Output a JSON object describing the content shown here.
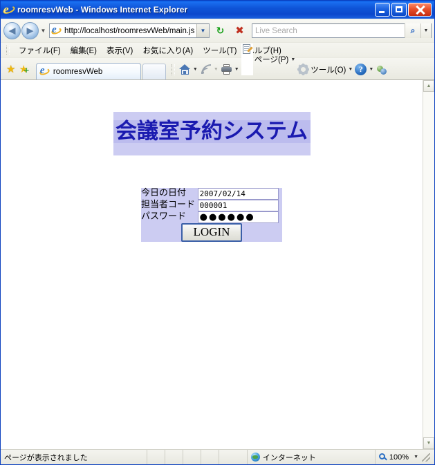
{
  "window": {
    "title": "roomresvWeb - Windows Internet Explorer",
    "minimize_label": "Minimize",
    "maximize_label": "Maximize",
    "close_label": "Close"
  },
  "navigation": {
    "back_glyph": "◀",
    "forward_glyph": "▶",
    "recent_caret": "▼",
    "url": "http://localhost/roomresvWeb/main.js",
    "url_dropdown_caret": "▼",
    "refresh_glyph": "↻",
    "stop_glyph": "✖"
  },
  "search": {
    "placeholder": "Live Search",
    "value": "",
    "go_glyph": "⌕",
    "dropdown_caret": "▼"
  },
  "menu": {
    "items": [
      {
        "label": "ファイル(F)",
        "accel": "F"
      },
      {
        "label": "編集(E)",
        "accel": "E"
      },
      {
        "label": "表示(V)",
        "accel": "V"
      },
      {
        "label": "お気に入り(A)",
        "accel": "A"
      },
      {
        "label": "ツール(T)",
        "accel": "T"
      },
      {
        "label": "ヘルプ(H)",
        "accel": "H"
      }
    ]
  },
  "favorites": {
    "center_star": "★",
    "add_star": "★",
    "add_plus": "+"
  },
  "tabs": [
    {
      "label": "roomresvWeb",
      "active": true
    }
  ],
  "commands": [
    {
      "name": "home",
      "label": "",
      "caret": "▼"
    },
    {
      "name": "feeds",
      "label": "",
      "caret": "▼"
    },
    {
      "name": "print",
      "label": "",
      "caret": "▼"
    },
    {
      "name": "page",
      "label": "ページ(P)",
      "caret": "▼"
    },
    {
      "name": "tools",
      "label": "ツール(O)",
      "caret": "▼"
    },
    {
      "name": "help",
      "label": "",
      "caret": "▼"
    },
    {
      "name": "messenger",
      "label": "",
      "caret": ""
    }
  ],
  "page": {
    "banner_title": "会議室予約システム",
    "form": {
      "rows": [
        {
          "label": "今日の日付",
          "value": "2007/02/14",
          "type": "text"
        },
        {
          "label": "担当者コード",
          "value": "000001",
          "type": "text"
        },
        {
          "label": "パスワード",
          "value": "●●●●●●",
          "type": "password"
        }
      ],
      "submit_label": "LOGIN"
    },
    "colors": {
      "banner_bg": "#ccccf2",
      "banner_text": "#1a1ab0",
      "form_bg": "#ccccf2"
    }
  },
  "scrollbar": {
    "up_glyph": "▲",
    "down_glyph": "▼"
  },
  "statusbar": {
    "message": "ページが表示されました",
    "zone": "インターネット",
    "zoom": "100%",
    "zoom_caret": "▼"
  }
}
